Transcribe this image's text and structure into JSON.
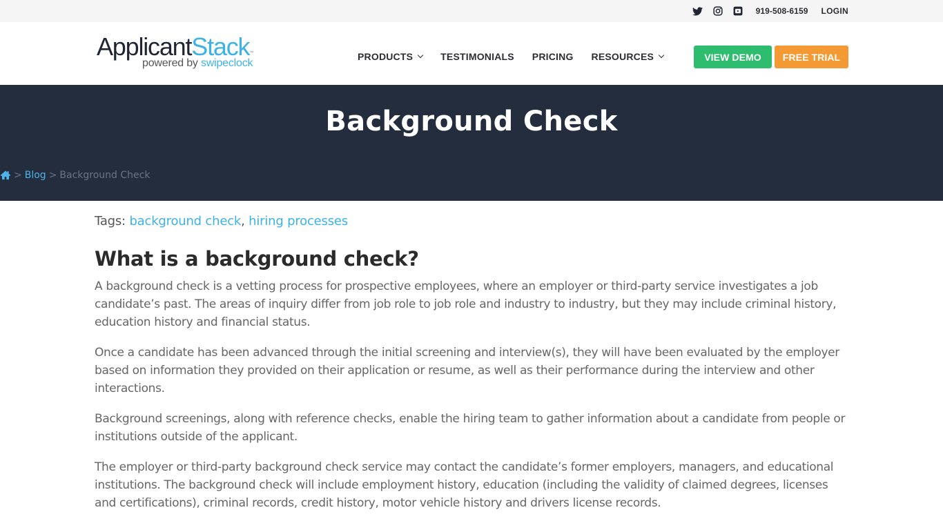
{
  "topbar": {
    "social": [
      {
        "icon": "twitter-icon"
      },
      {
        "icon": "instagram-icon"
      },
      {
        "icon": "youtube-icon"
      }
    ],
    "phone": "919-508-6159",
    "login": "LOGIN"
  },
  "header": {
    "logo": {
      "word1": "Applicant",
      "word2": "Stack",
      "tm": "™",
      "tagline_prefix": "powered by ",
      "tagline_brand": "swipeclock"
    },
    "nav": [
      {
        "label": "PRODUCTS",
        "has_dropdown": true
      },
      {
        "label": "TESTIMONIALS",
        "has_dropdown": false
      },
      {
        "label": "PRICING",
        "has_dropdown": false
      },
      {
        "label": "RESOURCES",
        "has_dropdown": true
      }
    ],
    "demo_button": "VIEW DEMO",
    "trial_button": "FREE TRIAL",
    "colors": {
      "demo": "#2ebd6e",
      "trial": "#f49a35",
      "accent": "#3db2e6"
    }
  },
  "hero": {
    "title": "Background Check",
    "breadcrumb": {
      "home_icon": "home-icon",
      "sep": ">",
      "blog": "Blog",
      "current": "Background Check"
    },
    "bg_color": "#242d3e"
  },
  "article": {
    "tags_label": "Tags: ",
    "tags": [
      "background check",
      "hiring processes"
    ],
    "tag_sep": ", ",
    "heading": "What is a background check?",
    "paragraphs": [
      "A background check is a vetting process for prospective employees, where an employer or third-party service investigates a job candidate’s past. The areas of inquiry differ from job role to job role and industry to industry, but they may include criminal history, education history and financial status.",
      "Once a candidate has been advanced through the initial screening and interview(s), they will have been evaluated by the employer based on information they provided on their application or resume, as well as their performance during the interview and other interactions.",
      "Background screenings, along with reference checks, enable the hiring team to gather information about a candidate from people or institutions outside of the applicant.",
      "The employer or third-party background check service may contact the candidate’s former employers, managers, and educational institutions. The background check will include employment history, education (including the validity of claimed degrees, licenses and certifications), criminal records, credit history, motor vehicle history and drivers license records."
    ]
  }
}
